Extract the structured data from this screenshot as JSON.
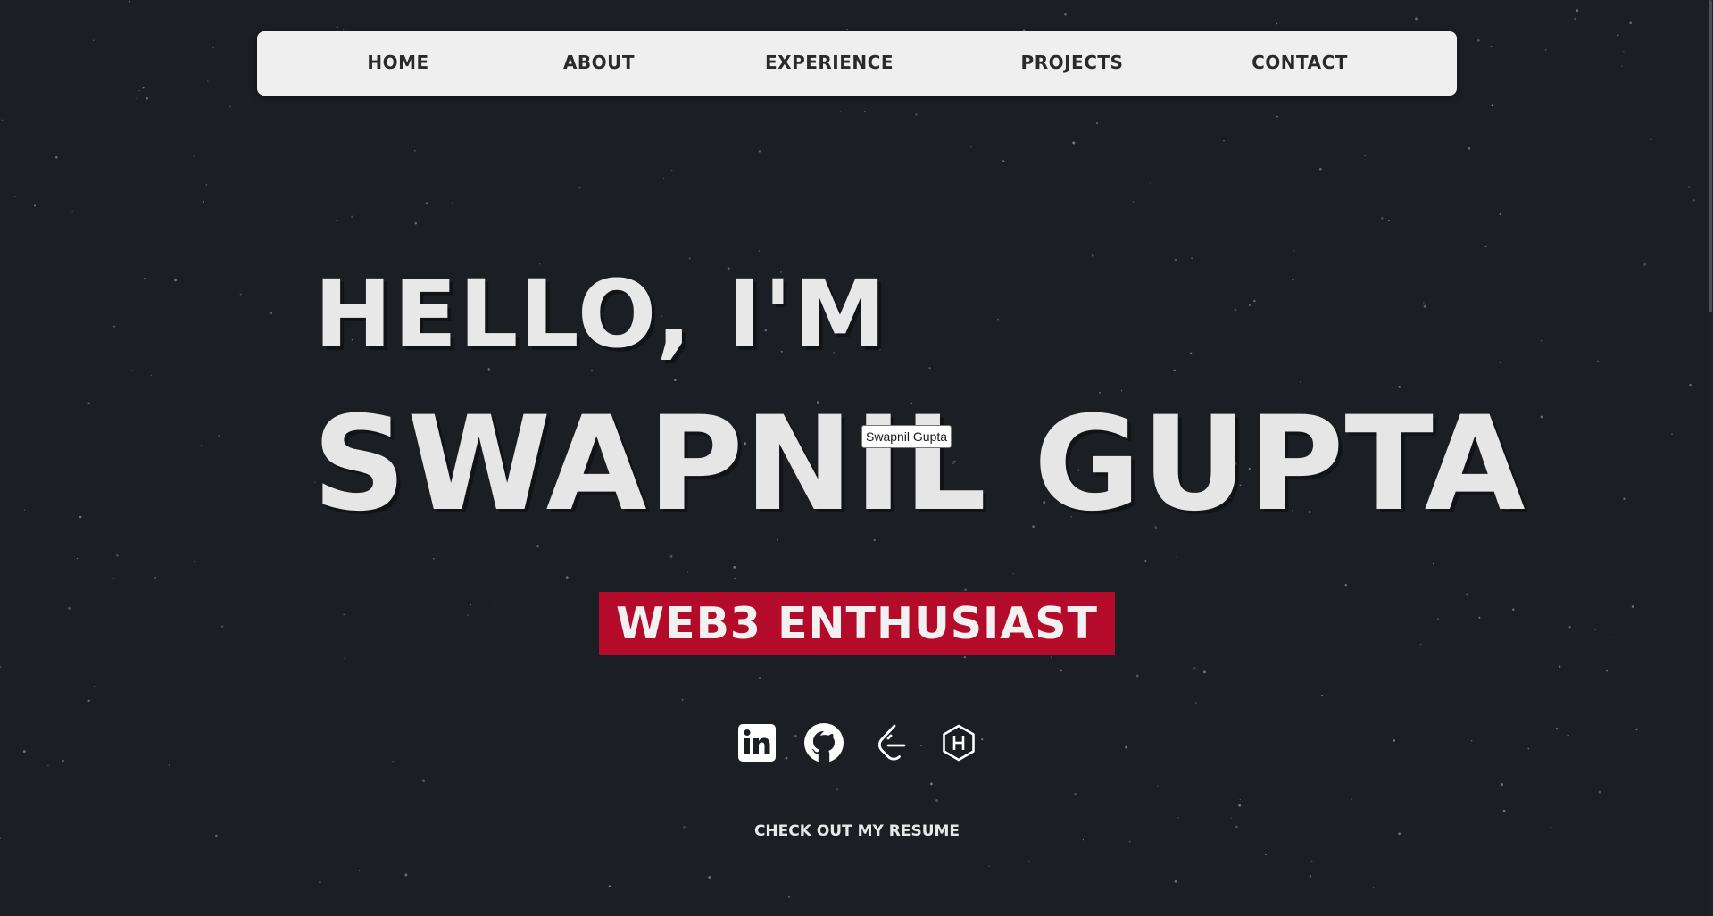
{
  "nav": {
    "items": [
      {
        "label": "HOME"
      },
      {
        "label": "ABOUT"
      },
      {
        "label": "EXPERIENCE"
      },
      {
        "label": "PROJECTS"
      },
      {
        "label": "CONTACT"
      }
    ]
  },
  "hero": {
    "greeting": "HELLO, I'M",
    "name": "SWAPNIL GUPTA",
    "tooltip": "Swapnil Gupta",
    "tagline": "WEB3 ENTHUSIAST",
    "resume_link": "CHECK OUT MY RESUME"
  },
  "social": [
    {
      "icon": "linkedin-icon"
    },
    {
      "icon": "github-icon"
    },
    {
      "icon": "leetcode-icon"
    },
    {
      "icon": "hackerrank-icon"
    }
  ],
  "colors": {
    "background": "#1b1e23",
    "navbar": "#efefef",
    "accent": "#b50b2a",
    "text_light": "#e8e8e8"
  }
}
